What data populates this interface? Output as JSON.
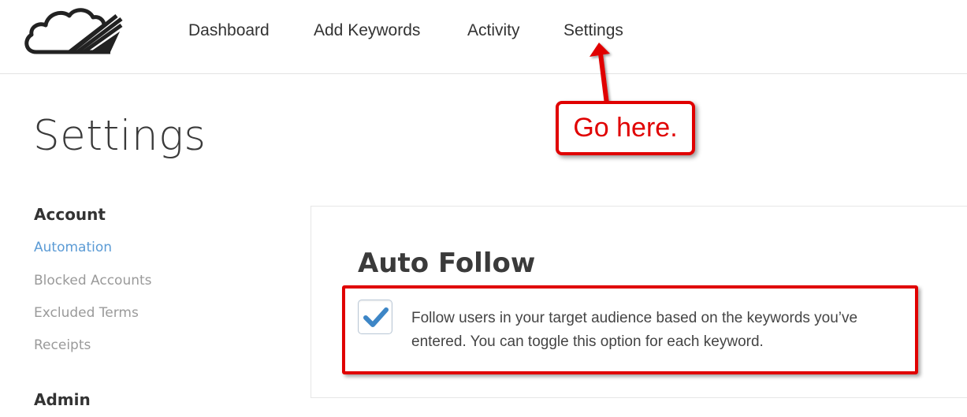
{
  "nav": {
    "items": [
      {
        "label": "Dashboard"
      },
      {
        "label": "Add Keywords"
      },
      {
        "label": "Activity"
      },
      {
        "label": "Settings"
      }
    ]
  },
  "page": {
    "title": "Settings"
  },
  "sidebar": {
    "sections": [
      {
        "heading": "Account",
        "items": [
          {
            "label": "Automation",
            "active": true
          },
          {
            "label": "Blocked Accounts"
          },
          {
            "label": "Excluded Terms"
          },
          {
            "label": "Receipts"
          }
        ]
      },
      {
        "heading": "Admin",
        "items": []
      }
    ]
  },
  "auto_follow": {
    "title": "Auto Follow",
    "checked": true,
    "description": "Follow users in your target audience based on the keywords you’ve entered. You can toggle this option for each keyword."
  },
  "annotation": {
    "callout_text": "Go here.",
    "color": "#e00000"
  },
  "colors": {
    "accent": "#5b9bd5",
    "muted_link": "#9a9a9a",
    "annotation_red": "#e00000"
  },
  "icons": [
    "cloud-logo-icon",
    "checkmark-icon"
  ]
}
